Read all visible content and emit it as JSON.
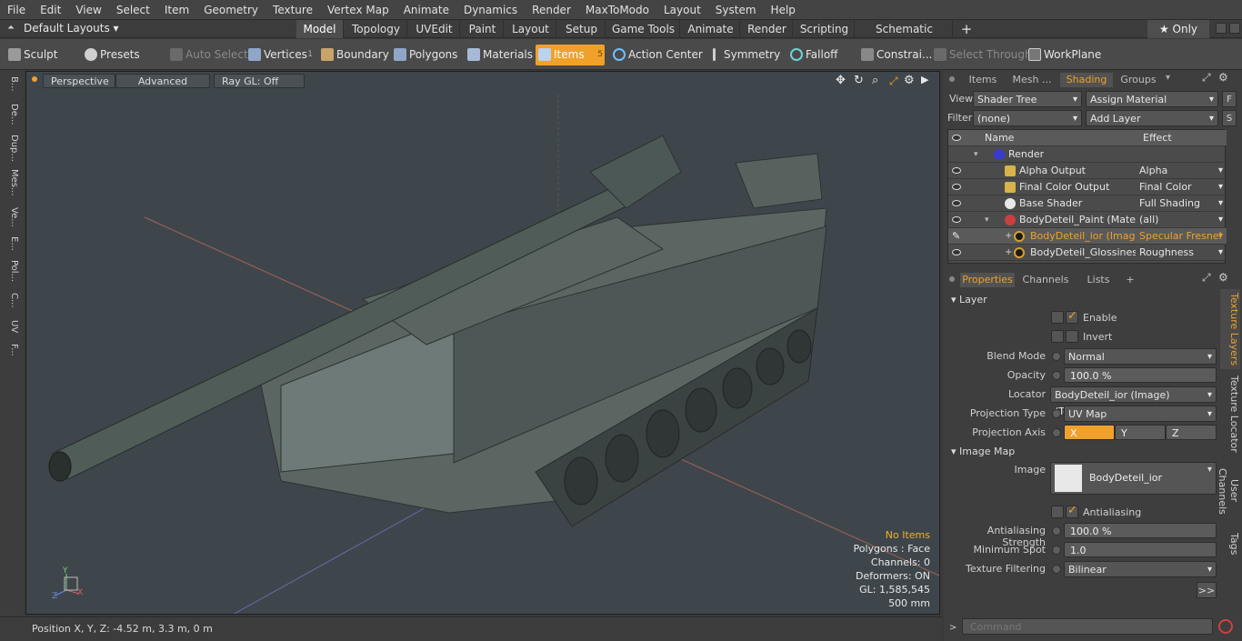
{
  "menu": [
    "File",
    "Edit",
    "View",
    "Select",
    "Item",
    "Geometry",
    "Texture",
    "Vertex Map",
    "Animate",
    "Dynamics",
    "Render",
    "MaxToModo",
    "Layout",
    "System",
    "Help"
  ],
  "layouts": {
    "label": "Default Layouts ▾",
    "tabs": [
      "Model",
      "Topology",
      "UVEdit",
      "Paint",
      "Layout",
      "Setup",
      "Game Tools",
      "Animate",
      "Render",
      "Scripting",
      "Schematic Fusion"
    ],
    "plus": "+",
    "only": "★ Only"
  },
  "toolbar": {
    "sculpt": "Sculpt",
    "presets": "Presets",
    "auto_select": "Auto Select",
    "vertices": "Vertices",
    "vertices_count": "1",
    "boundary": "Boundary",
    "polygons": "Polygons",
    "materials": "Materials",
    "items": "Items",
    "items_count": "5",
    "action_center": "Action Center",
    "symmetry": "Symmetry",
    "falloff": "Falloff",
    "constraints": "Constrai...",
    "select_through": "Select Through",
    "workplane": "WorkPlane"
  },
  "lefttabs": [
    "B...",
    "De...",
    "Dup...",
    "Mes...",
    "Ve...",
    "E...",
    "Pol...",
    "C...",
    "UV",
    "F..."
  ],
  "viewport": {
    "perspective": "Perspective",
    "advanced": "Advanced",
    "raygl": "Ray GL: Off",
    "no_items": "No Items",
    "polygons": "Polygons : Face",
    "channels": "Channels: 0",
    "deformers": "Deformers: ON",
    "gl": "GL: 1,585,545",
    "scale": "500 mm",
    "axis_y": "Y",
    "axis_z": "Z",
    "axis_x": "X"
  },
  "status": {
    "position": "Position X, Y, Z:   -4.52 m, 3.3 m, 0 m"
  },
  "rightpanel": {
    "tabs": [
      "Items",
      "Mesh ...",
      "Shading",
      "Groups"
    ],
    "view_label": "View",
    "view_value": "Shader Tree",
    "assign_material": "Assign Material",
    "f_btn": "F",
    "filter_label": "Filter",
    "filter_value": "(none)",
    "add_layer": "Add Layer",
    "s_btn": "S",
    "col_name": "Name",
    "col_effect": "Effect",
    "rows": [
      {
        "name": "Render",
        "effect": ""
      },
      {
        "name": "Alpha Output",
        "effect": "Alpha"
      },
      {
        "name": "Final Color Output",
        "effect": "Final Color"
      },
      {
        "name": "Base Shader",
        "effect": "Full Shading"
      },
      {
        "name": "BodyDeteil_Paint (Mater...",
        "effect": "(all)"
      },
      {
        "name": "BodyDeteil_ior (Image)",
        "effect": "Specular Fresnel"
      },
      {
        "name": "BodyDeteil_Glossines ...",
        "effect": "Roughness"
      }
    ],
    "prop_tabs": [
      "Properties",
      "Channels",
      "Lists",
      "+"
    ],
    "layer_section": "Layer",
    "enable": "Enable",
    "invert": "Invert",
    "blend_mode_label": "Blend Mode",
    "blend_mode": "Normal",
    "opacity_label": "Opacity",
    "opacity": "100.0 %",
    "locator_label": "Locator",
    "locator": "BodyDeteil_ior (Image) (Texture)",
    "projection_type_label": "Projection Type",
    "projection_type": "UV Map",
    "projection_axis_label": "Projection Axis",
    "axis_x": "X",
    "axis_y": "Y",
    "axis_z": "Z",
    "image_map_section": "Image Map",
    "image_label": "Image",
    "image": "BodyDeteil_ior",
    "antialiasing": "Antialiasing",
    "aa_strength_label": "Antialiasing Strength",
    "aa_strength": "100.0 %",
    "min_spot_label": "Minimum Spot",
    "min_spot": "1.0",
    "tex_filter_label": "Texture Filtering",
    "tex_filter": "Bilinear",
    "more": ">>",
    "vtabs": [
      "Texture Layers",
      "Texture Locator",
      "User Channels",
      "Tags"
    ],
    "command_placeholder": "Command"
  }
}
